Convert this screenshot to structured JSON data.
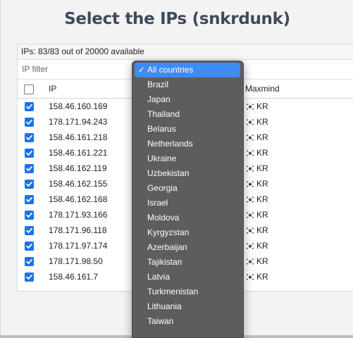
{
  "dialog": {
    "title": "Select the IPs (snkrdunk)",
    "availability": "IPs: 83/83 out of 20000 available",
    "filter_placeholder": "IP filter"
  },
  "table": {
    "columns": {
      "ip": "IP",
      "maxmind": "Maxmind"
    },
    "rows": [
      {
        "ip": "158.46.160.169",
        "country": "KR",
        "checked": true
      },
      {
        "ip": "178.171.94.243",
        "country": "KR",
        "checked": true
      },
      {
        "ip": "158.46.161.218",
        "country": "KR",
        "checked": true
      },
      {
        "ip": "158.46.161.221",
        "country": "KR",
        "checked": true
      },
      {
        "ip": "158.46.162.119",
        "country": "KR",
        "checked": true
      },
      {
        "ip": "158.46.162.155",
        "country": "KR",
        "checked": true
      },
      {
        "ip": "158.46.162.168",
        "country": "KR",
        "checked": true
      },
      {
        "ip": "178.171.93.166",
        "country": "KR",
        "checked": true
      },
      {
        "ip": "178.171.96.118",
        "country": "KR",
        "checked": true
      },
      {
        "ip": "178.171.97.174",
        "country": "KR",
        "checked": true
      },
      {
        "ip": "178.171.98.50",
        "country": "KR",
        "checked": true
      },
      {
        "ip": "158.46.161.7",
        "country": "KR",
        "checked": true
      }
    ]
  },
  "country_dropdown": {
    "selected": "All countries",
    "options": [
      "All countries",
      "Brazil",
      "Japan",
      "Thailand",
      "Belarus",
      "Netherlands",
      "Ukraine",
      "Uzbekistan",
      "Georgia",
      "Israel",
      "Moldova",
      "Kyrgyzstan",
      "Azerbaijan",
      "Tajikistan",
      "Latvia",
      "Turkmenistan",
      "Lithuania",
      "Taiwan"
    ]
  },
  "colors": {
    "checkbox": "#1a73e8",
    "dropdown_bg": "#5d5d5d",
    "dropdown_selected": "#3e8bf3",
    "title": "#3e4a5a"
  },
  "icons": {
    "check": "checkmark-icon",
    "flag": "kr-flag-icon"
  }
}
